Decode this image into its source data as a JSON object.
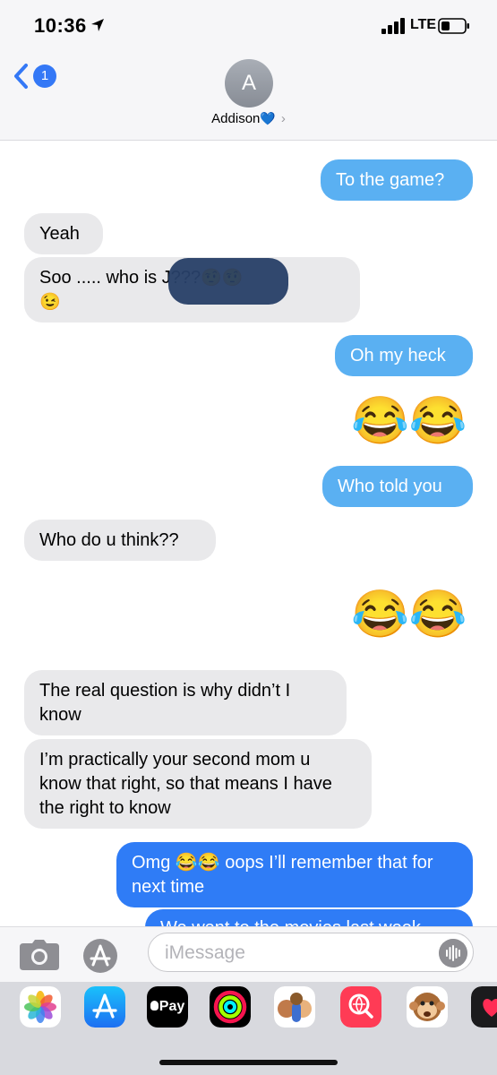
{
  "status_bar": {
    "time": "10:36",
    "network": "LTE",
    "icons": [
      "location-arrow-icon",
      "signal-bars-icon",
      "battery-icon"
    ]
  },
  "nav": {
    "back_badge": "1",
    "avatar_initial": "A",
    "contact_name": "Addison",
    "contact_emoji": "💙",
    "chevron": "›"
  },
  "messages": [
    {
      "side": "out",
      "type": "sms",
      "text": "To the game?"
    },
    {
      "side": "in",
      "text": "Yeah"
    },
    {
      "side": "in",
      "text_line1": "Soo ..... who is J",
      "text_obscured": "???",
      "emoji_line1": "🤨🤨",
      "emoji_line2": "😉"
    },
    {
      "side": "out",
      "type": "sms",
      "text": "Oh my heck"
    },
    {
      "side": "out",
      "type": "emoji",
      "text": "😂😂"
    },
    {
      "side": "out",
      "type": "sms",
      "text": "Who told you"
    },
    {
      "side": "in",
      "text": "Who do u think??"
    },
    {
      "side": "out",
      "type": "emoji",
      "text": "😂😂"
    },
    {
      "side": "in",
      "text": "The real question is why didn’t I know"
    },
    {
      "side": "in",
      "text": "I’m practically your second mom u know that right, so that means I have the right to know"
    },
    {
      "side": "out",
      "type": "imessage",
      "text": "Omg 😂😂 oops I’ll remember that for next time"
    },
    {
      "side": "out",
      "type": "imessage",
      "text": "We went to the movies last week"
    }
  ],
  "input": {
    "placeholder": "iMessage"
  },
  "app_drawer": {
    "apple_pay_label": "Pay",
    "apps": [
      "photos-app-icon",
      "app-store-app-icon",
      "apple-pay-app-icon",
      "activity-app-icon",
      "memoji-app-icon",
      "search-images-app-icon",
      "animoji-app-icon",
      "digital-touch-app-icon"
    ]
  },
  "colors": {
    "sms_bubble": "#5ab0f2",
    "imessage_bubble": "#2f7cf6",
    "incoming_bubble": "#e9e9eb",
    "accent": "#3478f6"
  }
}
